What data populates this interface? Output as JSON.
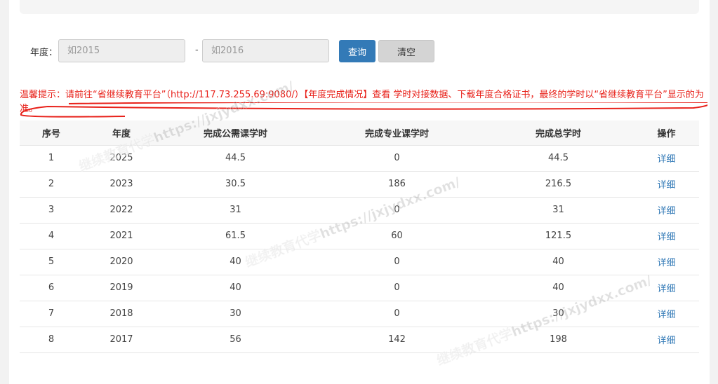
{
  "filter": {
    "year_label": "年度：",
    "year_start_placeholder": "如2015",
    "year_end_placeholder": "如2016",
    "separator": "-",
    "query_label": "查询",
    "clear_label": "清空"
  },
  "notice": {
    "text": "温馨提示：请前往“省继续教育平台”（http://117.73.255.69:9080/）【年度完成情况】查看 学时对接数据、下载年度合格证书，最终的学时以“省继续教育平台”显示的为准。"
  },
  "table": {
    "headers": [
      "序号",
      "年度",
      "完成公需课学时",
      "完成专业课学时",
      "完成总学时",
      "操作"
    ],
    "rows": [
      [
        "1",
        "2025",
        "44.5",
        "0",
        "44.5",
        "详细"
      ],
      [
        "2",
        "2023",
        "30.5",
        "186",
        "216.5",
        "详细"
      ],
      [
        "3",
        "2022",
        "31",
        "0",
        "31",
        "详细"
      ],
      [
        "4",
        "2021",
        "61.5",
        "60",
        "121.5",
        "详细"
      ],
      [
        "5",
        "2020",
        "40",
        "0",
        "40",
        "详细"
      ],
      [
        "6",
        "2019",
        "40",
        "0",
        "40",
        "详细"
      ],
      [
        "7",
        "2018",
        "30",
        "0",
        "30",
        "详细"
      ],
      [
        "8",
        "2017",
        "56",
        "142",
        "198",
        "详细"
      ]
    ]
  },
  "watermark": {
    "text": "继续教育代学https://jxjydxx.com/"
  },
  "colors": {
    "primary": "#337ab7",
    "notice": "#e8211a"
  }
}
